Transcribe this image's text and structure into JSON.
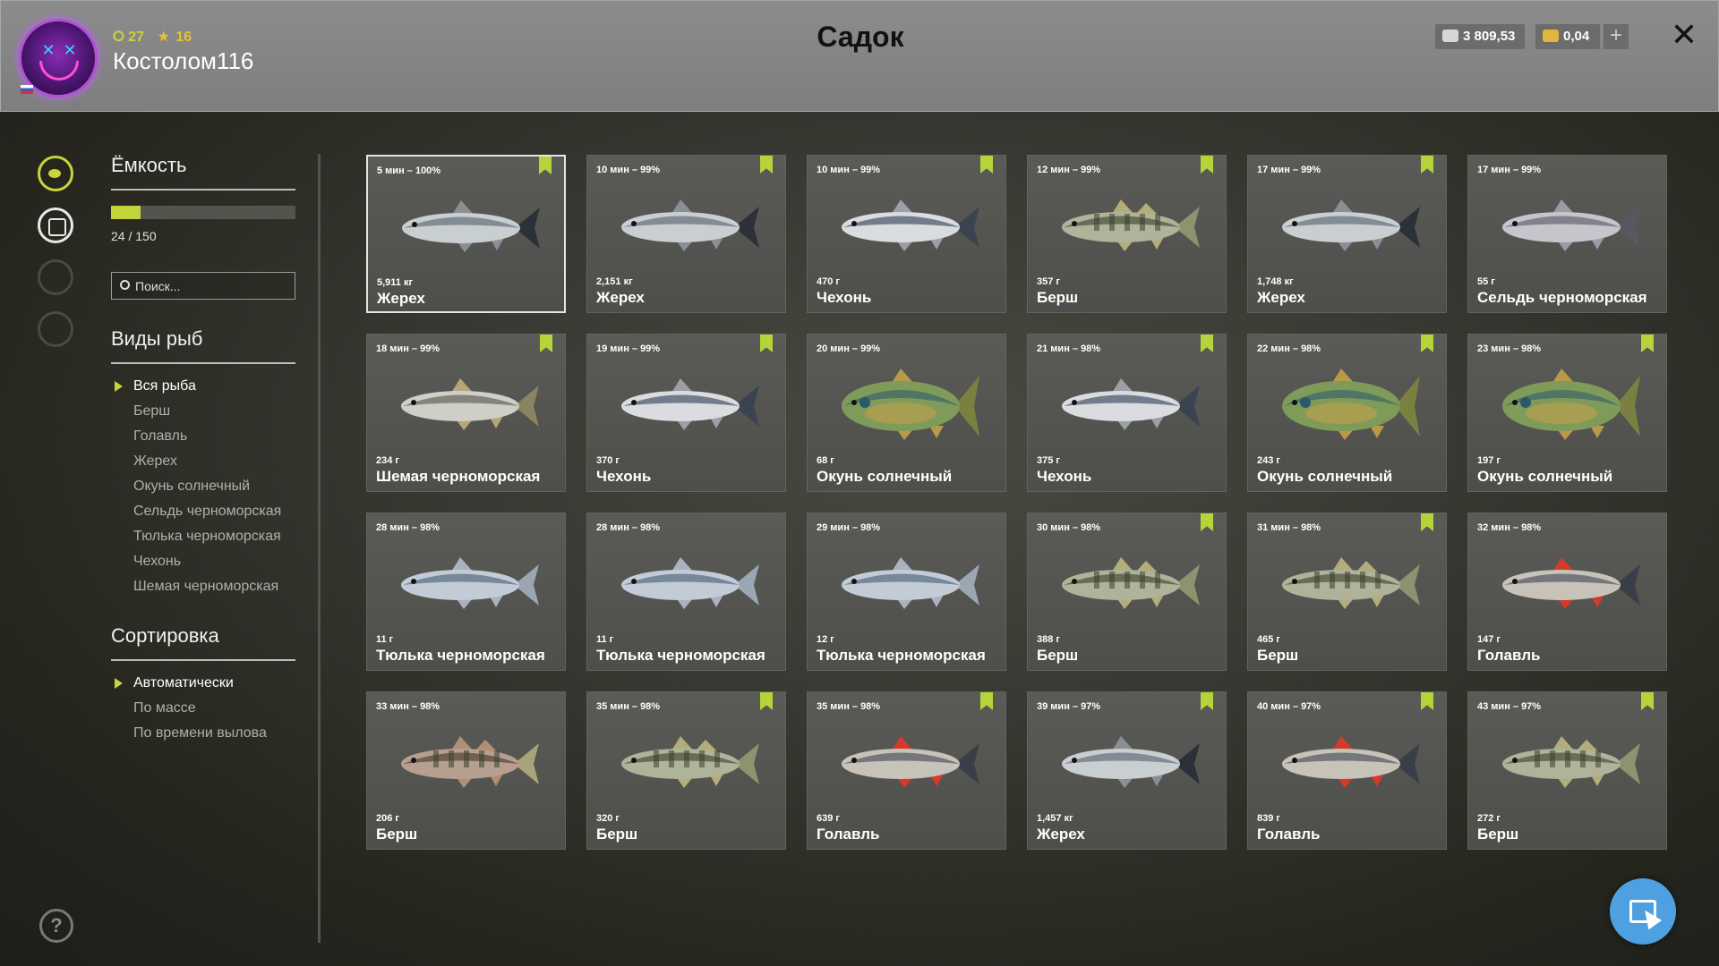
{
  "header": {
    "title": "Садок",
    "username": "Костолом116",
    "level": "27",
    "stars": "16",
    "silver": "3 809,53",
    "gold": "0,04",
    "plus": "+",
    "close": "✕",
    "avatar_icon": "neon-smiley-avatar-icon",
    "flag_icon": "russia-flag-icon"
  },
  "sidebar": {
    "capacity_title": "Ёмкость",
    "capacity_text": "24 / 150",
    "capacity_fraction": 0.16,
    "search_placeholder": "Поиск...",
    "species_title": "Виды рыб",
    "species": [
      "Вся рыба",
      "Берш",
      "Голавль",
      "Жерех",
      "Окунь солнечный",
      "Сельдь черноморская",
      "Тюлька черноморская",
      "Чехонь",
      "Шемая черноморская"
    ],
    "sort_title": "Сортировка",
    "sort": [
      "Автоматически",
      "По массе",
      "По времени вылова"
    ],
    "help": "?",
    "accent": "#c8d43a"
  },
  "fish": [
    {
      "time": "5 мин – 100%",
      "weight": "5,911 кг",
      "name": "Жерех",
      "marked": true,
      "kind": "asp"
    },
    {
      "time": "10 мин – 99%",
      "weight": "2,151 кг",
      "name": "Жерех",
      "marked": true,
      "kind": "asp"
    },
    {
      "time": "10 мин – 99%",
      "weight": "470 г",
      "name": "Чехонь",
      "marked": true,
      "kind": "sabre"
    },
    {
      "time": "12 мин – 99%",
      "weight": "357 г",
      "name": "Берш",
      "marked": true,
      "kind": "perch"
    },
    {
      "time": "17 мин – 99%",
      "weight": "1,748 кг",
      "name": "Жерех",
      "marked": true,
      "kind": "asp"
    },
    {
      "time": "17 мин – 99%",
      "weight": "55 г",
      "name": "Сельдь черноморская",
      "marked": false,
      "kind": "herring"
    },
    {
      "time": "18 мин – 99%",
      "weight": "234 г",
      "name": "Шемая черноморская",
      "marked": true,
      "kind": "shemaya"
    },
    {
      "time": "19 мин – 99%",
      "weight": "370 г",
      "name": "Чехонь",
      "marked": true,
      "kind": "sabre"
    },
    {
      "time": "20 мин – 99%",
      "weight": "68 г",
      "name": "Окунь солнечный",
      "marked": false,
      "kind": "sunfish"
    },
    {
      "time": "21 мин – 98%",
      "weight": "375 г",
      "name": "Чехонь",
      "marked": true,
      "kind": "sabre"
    },
    {
      "time": "22 мин – 98%",
      "weight": "243 г",
      "name": "Окунь солнечный",
      "marked": true,
      "kind": "sunfish"
    },
    {
      "time": "23 мин – 98%",
      "weight": "197 г",
      "name": "Окунь солнечный",
      "marked": true,
      "kind": "sunfish"
    },
    {
      "time": "28 мин – 98%",
      "weight": "11 г",
      "name": "Тюлька черноморская",
      "marked": false,
      "kind": "sprat"
    },
    {
      "time": "28 мин – 98%",
      "weight": "11 г",
      "name": "Тюлька черноморская",
      "marked": false,
      "kind": "sprat"
    },
    {
      "time": "29 мин – 98%",
      "weight": "12 г",
      "name": "Тюлька черноморская",
      "marked": false,
      "kind": "sprat"
    },
    {
      "time": "30 мин – 98%",
      "weight": "388 г",
      "name": "Берш",
      "marked": true,
      "kind": "perch"
    },
    {
      "time": "31 мин – 98%",
      "weight": "465 г",
      "name": "Берш",
      "marked": true,
      "kind": "perch"
    },
    {
      "time": "32 мин – 98%",
      "weight": "147 г",
      "name": "Голавль",
      "marked": false,
      "kind": "chub"
    },
    {
      "time": "33 мин – 98%",
      "weight": "206 г",
      "name": "Берш",
      "marked": false,
      "kind": "perch-red"
    },
    {
      "time": "35 мин – 98%",
      "weight": "320 г",
      "name": "Берш",
      "marked": true,
      "kind": "perch"
    },
    {
      "time": "35 мин – 98%",
      "weight": "639 г",
      "name": "Голавль",
      "marked": true,
      "kind": "chub"
    },
    {
      "time": "39 мин – 97%",
      "weight": "1,457 кг",
      "name": "Жерех",
      "marked": true,
      "kind": "asp"
    },
    {
      "time": "40 мин – 97%",
      "weight": "839 г",
      "name": "Голавль",
      "marked": true,
      "kind": "chub"
    },
    {
      "time": "43 мин – 97%",
      "weight": "272 г",
      "name": "Берш",
      "marked": true,
      "kind": "perch"
    }
  ]
}
